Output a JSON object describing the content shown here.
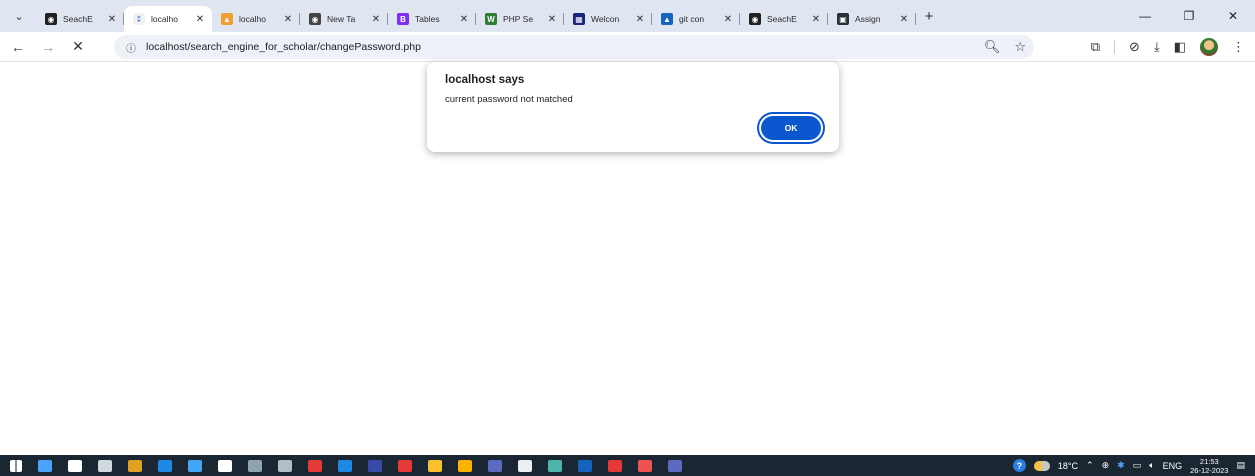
{
  "window": {
    "controls": {
      "minimize": "—",
      "restore": "❐",
      "close": "✕"
    }
  },
  "tabs": [
    {
      "label": "SeachE",
      "favicon_color": "#1f1f1f",
      "favicon_glyph": "◉",
      "active": false
    },
    {
      "label": "localho",
      "favicon_color": "#f2f2f2",
      "favicon_glyph": "⁑",
      "active": true
    },
    {
      "label": "localho",
      "favicon_color": "#f0a030",
      "favicon_glyph": "▲",
      "active": false
    },
    {
      "label": "New Ta",
      "favicon_color": "#444444",
      "favicon_glyph": "◉",
      "active": false
    },
    {
      "label": "Tables",
      "favicon_color": "#7b2ff7",
      "favicon_glyph": "B",
      "active": false
    },
    {
      "label": "PHP Se",
      "favicon_color": "#2e7d32",
      "favicon_glyph": "W",
      "active": false
    },
    {
      "label": "Welcon",
      "favicon_color": "#1a237e",
      "favicon_glyph": "▦",
      "active": false
    },
    {
      "label": "git con",
      "favicon_color": "#1565c0",
      "favicon_glyph": "▲",
      "active": false
    },
    {
      "label": "SeachE",
      "favicon_color": "#1f1f1f",
      "favicon_glyph": "◉",
      "active": false
    },
    {
      "label": "Assign",
      "favicon_color": "#263238",
      "favicon_glyph": "▣",
      "active": false
    }
  ],
  "tab_close_glyph": "✕",
  "new_tab_glyph": "+",
  "toolbar": {
    "back_glyph": "←",
    "forward_glyph": "→",
    "stop_glyph": "✕",
    "url": "localhost/search_engine_for_scholar/changePassword.php"
  },
  "dialog": {
    "title": "localhost says",
    "message": "current password not matched",
    "ok_label": "OK"
  },
  "taskbar": {
    "icon_colors": [
      "#4aa3ff",
      "#ffffff",
      "#cfd8dc",
      "#e0a020",
      "#1e88e5",
      "#42a5f5",
      "#ffffff",
      "#90a4ae",
      "#b0bec5",
      "#e53935",
      "#1e88e5",
      "#3949ab",
      "#e53935",
      "#fbc02d",
      "#ffb300",
      "#5c6bc0",
      "#eceff1",
      "#4db6ac",
      "#1565c0",
      "#e53935",
      "#ef5350",
      "#5c6bc0"
    ],
    "temperature": "18°C",
    "language": "ENG",
    "time": "21:53",
    "date": "26-12-2023"
  }
}
